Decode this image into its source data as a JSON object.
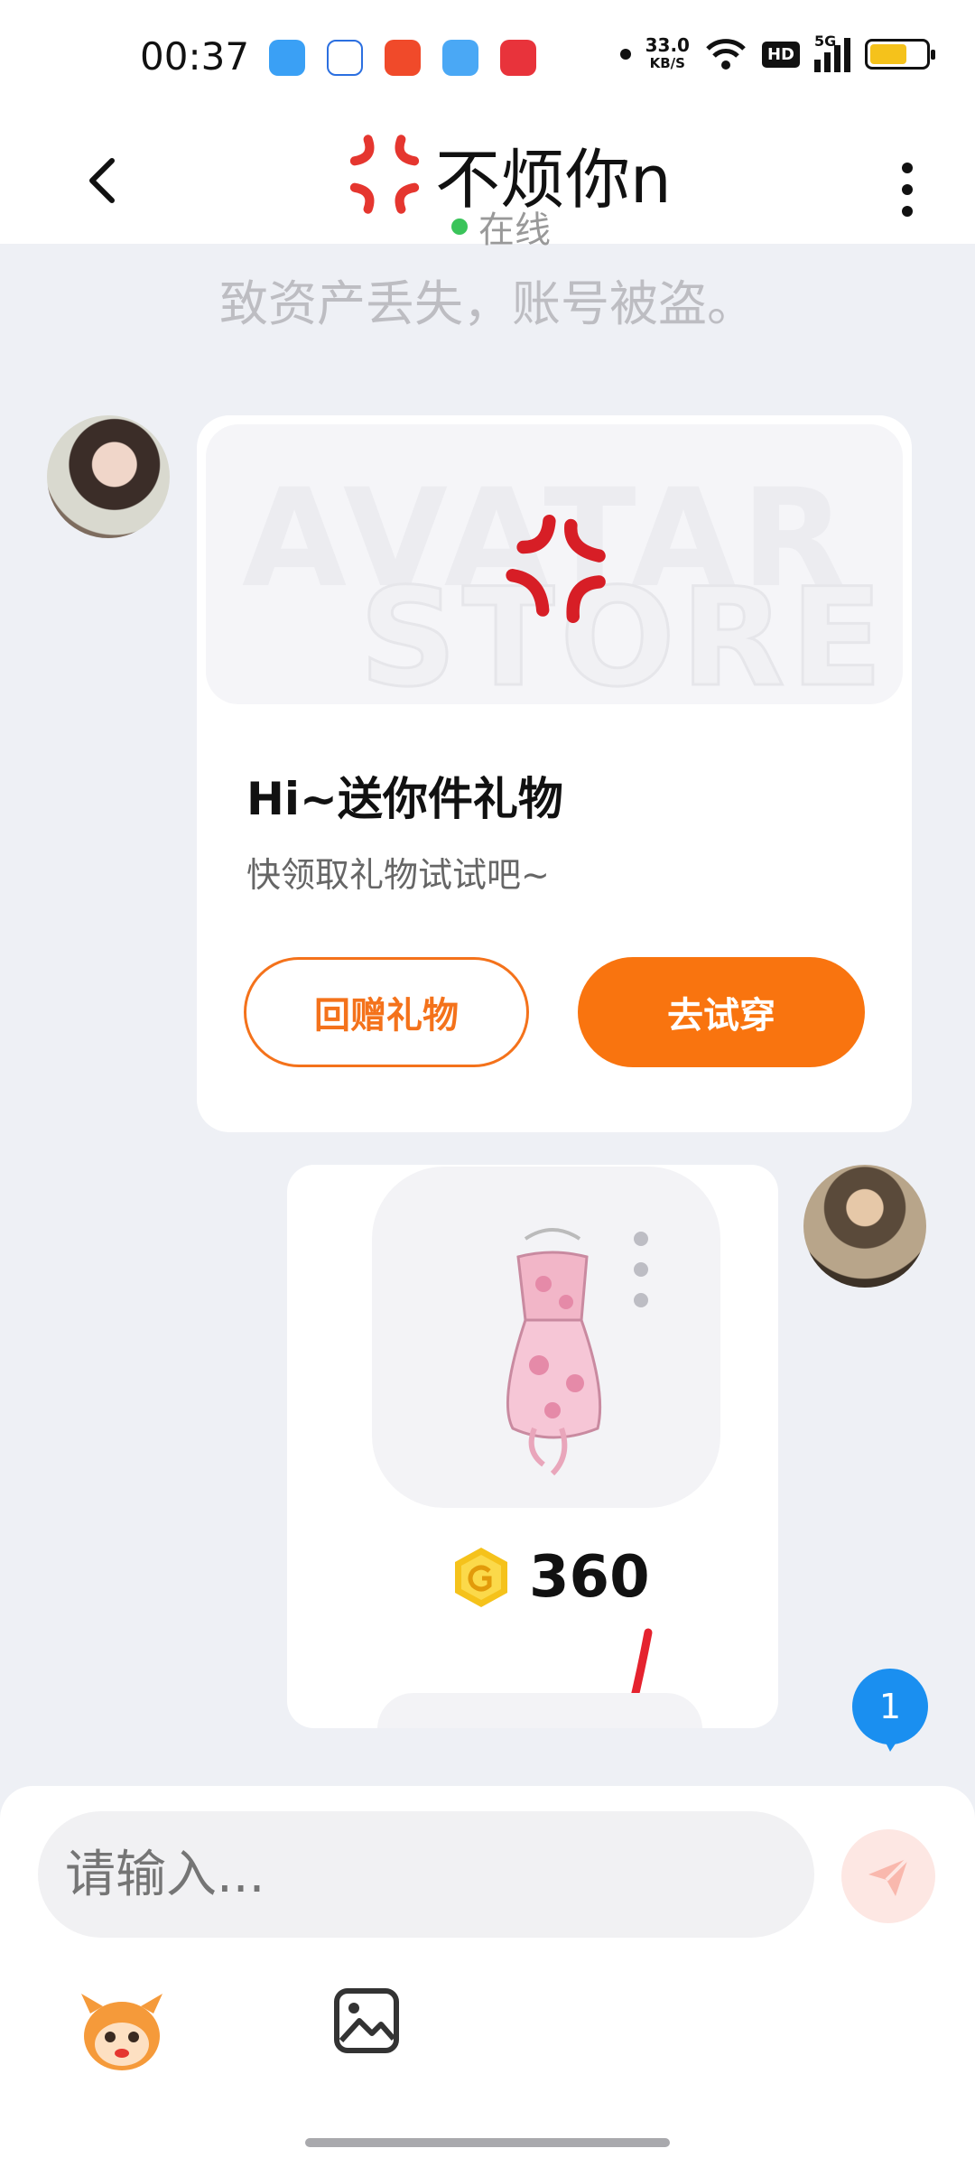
{
  "status_bar": {
    "time": "00:37",
    "net_speed_value": "33.0",
    "net_speed_unit": "KB/S",
    "hd_label": "HD",
    "network_type": "5G",
    "battery_level": 0.7
  },
  "header": {
    "contact_name": "不烦你n",
    "online_status": "在线"
  },
  "warning_text": "致资产丢失，账号被盗。",
  "gift_card": {
    "banner_text_1": "AVATAR",
    "banner_text_2": "STORE",
    "title": "Hi~送你件礼物",
    "subtitle": "快领取礼物试试吧~",
    "return_gift_label": "回赠礼物",
    "try_on_label": "去试穿"
  },
  "item_card": {
    "price": "360"
  },
  "unread_badge": "1",
  "composer": {
    "placeholder": "请输入..."
  },
  "colors": {
    "accent": "#f9740f",
    "online": "#3ac45a",
    "badge": "#1a8ff0"
  }
}
